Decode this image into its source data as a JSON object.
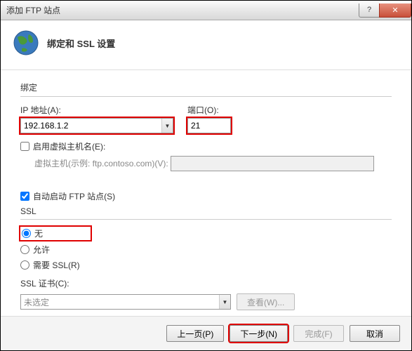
{
  "titlebar": {
    "title": "添加 FTP 站点",
    "help": "?",
    "close": "✕"
  },
  "header": {
    "title": "绑定和 SSL 设置"
  },
  "binding": {
    "group_label": "绑定",
    "ip_label": "IP 地址(A):",
    "ip_value": "192.168.1.2",
    "port_label": "端口(O):",
    "port_value": "21",
    "vhost_enable_label": "启用虚拟主机名(E):",
    "vhost_label": "虚拟主机(示例: ftp.contoso.com)(V):",
    "vhost_value": ""
  },
  "autostart": {
    "label": "自动启动 FTP 站点(S)"
  },
  "ssl": {
    "group_label": "SSL",
    "none_label": "无",
    "allow_label": "允许",
    "require_label": "需要 SSL(R)",
    "cert_label": "SSL 证书(C):",
    "cert_value": "未选定",
    "view_label": "查看(W)..."
  },
  "footer": {
    "prev": "上一页(P)",
    "next": "下一步(N)",
    "finish": "完成(F)",
    "cancel": "取消"
  }
}
